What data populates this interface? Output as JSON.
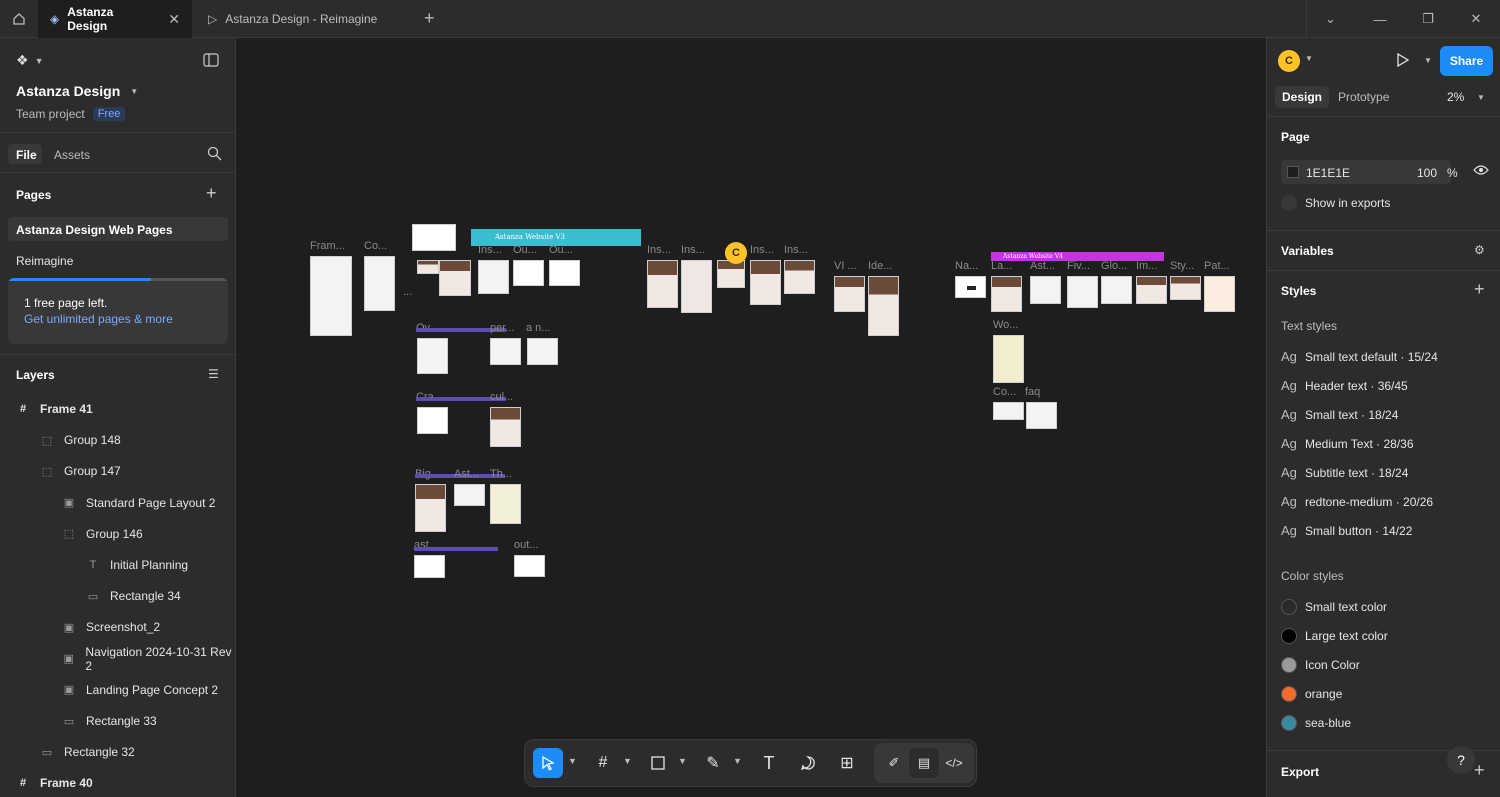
{
  "titlebar": {
    "tabs": [
      {
        "label": "Astanza Design",
        "active": true
      },
      {
        "label": "Astanza Design - Reimagine",
        "active": false
      }
    ]
  },
  "left": {
    "project_name": "Astanza Design",
    "team_label": "Team project",
    "plan_badge": "Free",
    "tab_file": "File",
    "tab_assets": "Assets",
    "pages_heading": "Pages",
    "pages": [
      "Astanza Design Web Pages",
      "Reimagine"
    ],
    "promo_text": "1 free page left.",
    "promo_link": "Get unlimited pages & more",
    "promo_progress": 0.65,
    "layers_heading": "Layers",
    "layers": [
      {
        "label": "Frame 41",
        "icon": "frame-icon"
      },
      {
        "label": "Group 148",
        "icon": "group-icon"
      },
      {
        "label": "Group 147",
        "icon": "group-icon"
      },
      {
        "label": "Standard Page Layout 2",
        "icon": "image-icon"
      },
      {
        "label": "Group 146",
        "icon": "group-icon"
      },
      {
        "label": "Initial Planning",
        "icon": "text-icon"
      },
      {
        "label": "Rectangle 34",
        "icon": "rectangle-icon"
      },
      {
        "label": "Screenshot_2",
        "icon": "image-icon"
      },
      {
        "label": "Navigation 2024-10-31 Rev 2",
        "icon": "image-icon"
      },
      {
        "label": "Landing Page Concept 2",
        "icon": "image-icon"
      },
      {
        "label": "Rectangle 33",
        "icon": "rectangle-icon"
      },
      {
        "label": "Rectangle 32",
        "icon": "rectangle-icon"
      },
      {
        "label": "Frame 40",
        "icon": "frame-icon"
      }
    ]
  },
  "canvas": {
    "banner_v3": "Astanza Website V3",
    "banner_v4": "Astanza Website V4",
    "cursor_user": "C",
    "labels": {
      "fram": "Fram...",
      "co": "Co...",
      "ins1": "Ins...",
      "ou1": "Ou...",
      "ou2": "Ou...",
      "ins2": "Ins...",
      "ins3": "Ins...",
      "ins4": "Ins...",
      "ins5": "Ins...",
      "vi": "VI ...",
      "ide": "Ide...",
      "na": "Na...",
      "la": "La...",
      "ast": "Ast...",
      "fiv": "Fiv...",
      "glo": "Glo...",
      "im": "Im...",
      "sty": "Sty...",
      "pat": "Pat...",
      "wo": "Wo...",
      "co2": "Co...",
      "faq": "faq",
      "ov": "Ov...",
      "per": "per...",
      "an": "a n...",
      "cra": "Cra...",
      "cul": "cul...",
      "big": "Big...",
      "ast2": "Ast...",
      "th": "Th...",
      "ast3": "ast...",
      "out": "out...",
      "dots": "..."
    }
  },
  "right": {
    "user_initial": "C",
    "share_label": "Share",
    "tab_design": "Design",
    "tab_prototype": "Prototype",
    "zoom": "2%",
    "page_heading": "Page",
    "page_color": "1E1E1E",
    "page_opacity": "100",
    "percent": "%",
    "show_exports": "Show in exports",
    "variables_heading": "Variables",
    "styles_heading": "Styles",
    "text_styles_heading": "Text styles",
    "text_styles": [
      "Small text default · 15/24",
      "Header text · 36/45",
      "Small text · 18/24",
      "Medium Text · 28/36",
      "Subtitle text · 18/24",
      "redtone-medium · 20/26",
      "Small button · 14/22"
    ],
    "color_styles_heading": "Color styles",
    "color_styles": [
      {
        "label": "Small text color",
        "color": "#2a2a2a"
      },
      {
        "label": "Large text color",
        "color": "#000000"
      },
      {
        "label": "Icon Color",
        "color": "#9a9a9a"
      },
      {
        "label": "orange",
        "color": "#f26b2c"
      },
      {
        "label": "sea-blue",
        "color": "#3a8aa0"
      }
    ],
    "export_heading": "Export",
    "help": "?"
  },
  "colors": {
    "accent": "#1d8cf8",
    "banner_v3": "#3bbccf",
    "banner_v4": "#c534e0",
    "avatar": "#ffc328"
  }
}
